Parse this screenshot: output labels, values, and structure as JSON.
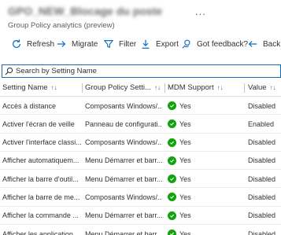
{
  "header": {
    "title": "GPO_NEW_Blocage du poste",
    "more": "...",
    "subtitle": "Group Policy analytics (preview)"
  },
  "toolbar": {
    "refresh": "Refresh",
    "migrate": "Migrate",
    "filter": "Filter",
    "export": "Export",
    "feedback": "Got feedback?",
    "back": "Back"
  },
  "search": {
    "placeholder": "Search by Setting Name"
  },
  "table": {
    "columns": [
      "Setting Name",
      "Group Policy Setti...",
      "MDM Support",
      "Value"
    ],
    "rows": [
      {
        "name": "Accès à distance",
        "gp": "Composants Windows/...",
        "mdm": "Yes",
        "value": "Disabled"
      },
      {
        "name": "Activer l'écran de veille",
        "gp": "Panneau de configurati...",
        "mdm": "Yes",
        "value": "Enabled"
      },
      {
        "name": "Activer l'interface classi...",
        "gp": "Composants Windows/...",
        "mdm": "Yes",
        "value": "Disabled"
      },
      {
        "name": "Afficher automatiquem...",
        "gp": "Menu Démarrer et barr...",
        "mdm": "Yes",
        "value": "Disabled"
      },
      {
        "name": "Afficher la barre d'outil...",
        "gp": "Menu Démarrer et barr...",
        "mdm": "Yes",
        "value": "Disabled"
      },
      {
        "name": "Afficher la barre de me...",
        "gp": "Composants Windows/...",
        "mdm": "Yes",
        "value": "Disabled"
      },
      {
        "name": "Afficher la commande ...",
        "gp": "Menu Démarrer et barr...",
        "mdm": "Yes",
        "value": "Disabled"
      },
      {
        "name": "Afficher les application...",
        "gp": "Menu Démarrer et barr...",
        "mdm": "Yes",
        "value": "Disabled"
      }
    ]
  },
  "colors": {
    "accent": "#0f6cbd",
    "success": "#13a10e"
  }
}
